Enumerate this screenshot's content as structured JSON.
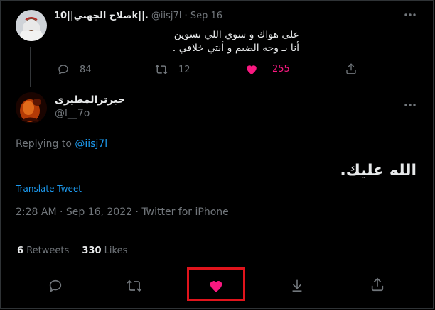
{
  "parent_tweet": {
    "display_name": "صلاح الجهني||10k||.",
    "handle": "@iisj7l",
    "separator": "·",
    "date": "Sep 16",
    "text_line1": "على هواك و سوي اللي تسوين",
    "text_line2": "أنا بـ وجه الضيم و أنتي خلافي .",
    "replies": "84",
    "retweets": "12",
    "likes": "255"
  },
  "main_tweet": {
    "display_name": "حبرترالمطيرى",
    "handle": "@l__7o",
    "replying_label": "Replying to",
    "replying_to": "@iisj7l",
    "text": "الله عليك.",
    "translate_label": "Translate Tweet",
    "timestamp": "2:28 AM · Sep 16, 2022 · Twitter for iPhone",
    "retweets_count": "6",
    "retweets_label": "Retweets",
    "likes_count": "330",
    "likes_label": "Likes"
  },
  "icons": {
    "reply": "reply-icon",
    "retweet": "retweet-icon",
    "like": "heart-icon",
    "bookmark": "bookmark-download-icon",
    "share": "share-icon",
    "more": "more-icon"
  },
  "colors": {
    "background": "#000000",
    "text": "#e7e9ea",
    "muted": "#71767b",
    "accent_blue": "#1d9bf0",
    "like_pink": "#f91880",
    "highlight_red": "#e0141c"
  }
}
